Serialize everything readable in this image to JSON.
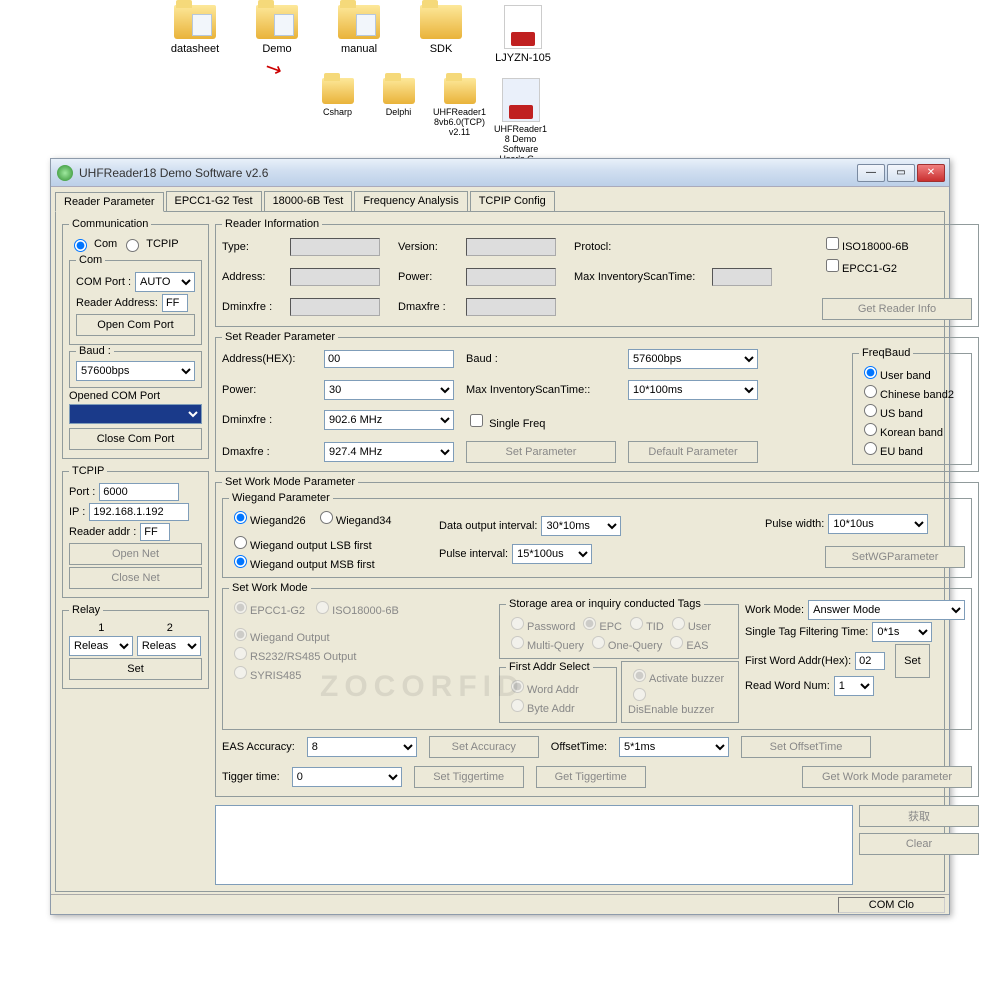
{
  "desktop": {
    "folders": [
      "datasheet",
      "Demo",
      "manual",
      "SDK",
      "LJYZN-105"
    ],
    "sub": [
      "Csharp",
      "Delphi",
      "UHFReader18vb6.0(TCP)v2.11",
      "UHFReader18 Demo Software User's G..."
    ]
  },
  "window": {
    "title": "UHFReader18 Demo Software v2.6"
  },
  "tabs": [
    "Reader Parameter",
    "EPCC1-G2 Test",
    "18000-6B Test",
    "Frequency Analysis",
    "TCPIP Config"
  ],
  "comm": {
    "legend": "Communication",
    "com": "Com",
    "tcpip": "TCPIP",
    "com_legend": "Com",
    "com_port_label": "COM Port :",
    "com_port": "AUTO",
    "reader_addr_label": "Reader Address:",
    "reader_addr": "FF",
    "open_com": "Open Com Port",
    "baud_legend": "Baud :",
    "baud": "57600bps",
    "opened_label": "Opened COM Port",
    "opened_val": "",
    "close_com": "Close Com Port",
    "tcpip_legend": "TCPIP",
    "port_label": "Port :",
    "port": "6000",
    "ip_label": "IP :",
    "ip": "192.168.1.192",
    "raddr_label": "Reader addr :",
    "raddr": "FF",
    "open_net": "Open Net",
    "close_net": "Close Net",
    "relay_legend": "Relay",
    "r1": "1",
    "r2": "2",
    "r1v": "Releas",
    "r2v": "Releas",
    "set": "Set"
  },
  "rinfo": {
    "legend": "Reader Information",
    "type": "Type:",
    "version": "Version:",
    "protocol": "Protocl:",
    "address": "Address:",
    "power": "Power:",
    "maxscan": "Max InventoryScanTime:",
    "dmin": "Dminxfre :",
    "dmax": "Dmaxfre :",
    "iso": "ISO18000-6B",
    "epc": "EPCC1-G2",
    "get": "Get Reader Info"
  },
  "setp": {
    "legend": "Set Reader Parameter",
    "addr_l": "Address(HEX):",
    "addr": "00",
    "baud_l": "Baud :",
    "baud": "57600bps",
    "power_l": "Power:",
    "power": "30",
    "maxscan_l": "Max InventoryScanTime::",
    "maxscan": "10*100ms",
    "dmin_l": "Dminxfre :",
    "dmin": "902.6 MHz",
    "single": "Single Freq",
    "dmax_l": "Dmaxfre :",
    "dmax": "927.4 MHz",
    "setbtn": "Set Parameter",
    "defbtn": "Default Parameter",
    "freq_legend": "FreqBaud",
    "fb": [
      "User band",
      "Chinese band2",
      "US band",
      "Korean band",
      "EU band"
    ]
  },
  "work": {
    "legend": "Set Work Mode Parameter",
    "wieg_legend": "Wiegand Parameter",
    "w26": "Wiegand26",
    "w34": "Wiegand34",
    "lsb": "Wiegand output LSB first",
    "msb": "Wiegand output MSB first",
    "dout_l": "Data output interval:",
    "dout": "30*10ms",
    "pulsew_l": "Pulse width:",
    "pulsew": "10*10us",
    "pulsei_l": "Pulse interval:",
    "pulsei": "15*100us",
    "setwg": "SetWGParameter",
    "swm_legend": "Set Work Mode",
    "epc": "EPCC1-G2",
    "iso": "ISO18000-6B",
    "out": [
      "Wiegand Output",
      "RS232/RS485 Output",
      "SYRIS485"
    ],
    "storage_legend": "Storage area or inquiry conducted Tags",
    "storage": [
      "Password",
      "EPC",
      "TID",
      "User",
      "Multi-Query",
      "One-Query",
      "EAS"
    ],
    "fas_legend": "First Addr Select",
    "fas": [
      "Word Addr",
      "Byte Addr"
    ],
    "setacc": "Set Accuracy",
    "buzz": [
      "Activate buzzer",
      "DisEnable buzzer"
    ],
    "wm_l": "Work Mode:",
    "wm": "Answer Mode",
    "stf_l": "Single Tag Filtering Time:",
    "stf": "0*1s",
    "fwa_l": "First Word Addr(Hex):",
    "fwa": "02",
    "rwn_l": "Read Word Num:",
    "rwn": "1",
    "set": "Set",
    "eas_l": "EAS Accuracy:",
    "eas": "8",
    "off_l": "OffsetTime:",
    "off": "5*1ms",
    "setoff": "Set OffsetTime",
    "tig_l": "Tigger time:",
    "tig": "0",
    "settig": "Set Tiggertime",
    "gettig": "Get Tiggertime",
    "getwm": "Get Work Mode parameter",
    "get_cn": "获取",
    "clear": "Clear"
  },
  "status": {
    "com": "COM Clo"
  },
  "watermark": "ZOCORFID"
}
